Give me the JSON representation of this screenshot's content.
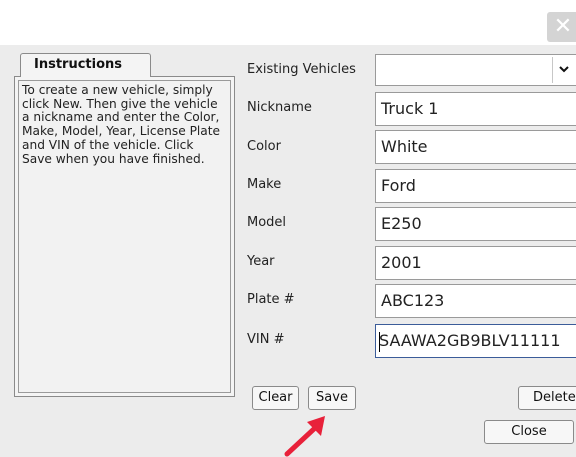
{
  "window": {
    "close_glyph": "✕"
  },
  "instructions": {
    "tab_label": "Instructions",
    "text": "To create a new vehicle, simply click New. Then give the vehicle a nickname and enter the Color, Make, Model, Year, License Plate and VIN of the vehicle. Click Save when you have finished."
  },
  "form": {
    "existing_vehicles_label": "Existing Vehicles",
    "existing_vehicles_value": "",
    "nickname_label": "Nickname",
    "nickname_value": "Truck 1",
    "color_label": "Color",
    "color_value": "White",
    "make_label": "Make",
    "make_value": "Ford",
    "model_label": "Model",
    "model_value": "E250",
    "year_label": "Year",
    "year_value": "2001",
    "plate_label": "Plate #",
    "plate_value": "ABC123",
    "vin_label": "VIN #",
    "vin_value": "SAAWA2GB9BLV11111"
  },
  "buttons": {
    "clear": "Clear",
    "save": "Save",
    "delete": "Delete",
    "close": "Close"
  },
  "colors": {
    "annotation_arrow": "#e8213a",
    "focus_border": "#3b5c99"
  },
  "icons": {
    "dropdown": "chevron-down-icon",
    "close": "close-icon",
    "annotation": "red-arrow-annotation"
  }
}
